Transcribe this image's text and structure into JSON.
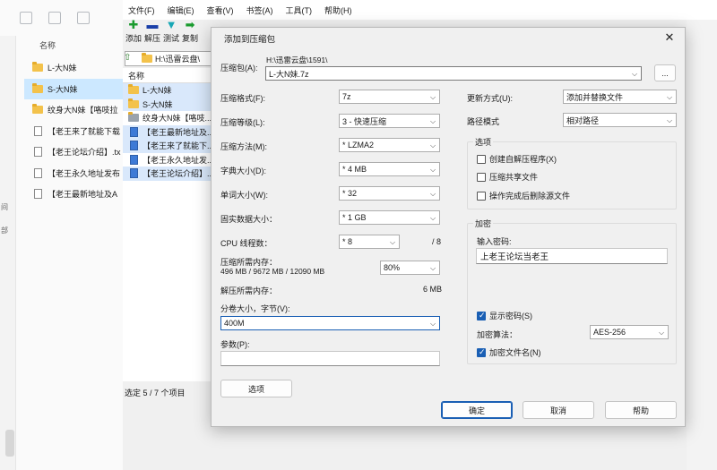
{
  "explorer": {
    "column_header": "名称",
    "gutter_chars": [
      "间",
      "部"
    ],
    "items": [
      {
        "name": "L-大N妹",
        "type": "folder",
        "selected": false
      },
      {
        "name": "S-大N妹",
        "type": "folder",
        "selected": true
      },
      {
        "name": "纹身大N妹【咯吱拉",
        "type": "folder",
        "selected": false
      },
      {
        "name": "【老王来了就能下载",
        "type": "doc",
        "selected": false
      },
      {
        "name": "【老王论坛介绍】.tx",
        "type": "doc",
        "selected": false
      },
      {
        "name": "【老王永久地址发布",
        "type": "doc",
        "selected": false
      },
      {
        "name": "【老王最新地址及A",
        "type": "doc",
        "selected": false
      }
    ]
  },
  "zip_window": {
    "menu": [
      "文件(F)",
      "编辑(E)",
      "查看(V)",
      "书签(A)",
      "工具(T)",
      "帮助(H)"
    ],
    "toolbar": [
      {
        "label": "添加",
        "icon": "add-icon",
        "color": "#1a9b2e",
        "glyph": "✚"
      },
      {
        "label": "解压",
        "icon": "extract-icon",
        "color": "#1a3fa8",
        "glyph": "▬"
      },
      {
        "label": "测试",
        "icon": "test-icon",
        "color": "#18a7b5",
        "glyph": "▼"
      },
      {
        "label": "复制",
        "icon": "copy-icon",
        "color": "#1a9b2e",
        "glyph": "➡"
      }
    ],
    "path": "H:\\迅雷云盘\\",
    "list_header": "名称",
    "files": [
      {
        "name": "L-大N妹",
        "type": "folder"
      },
      {
        "name": "S-大N妹",
        "type": "folder"
      },
      {
        "name": "纹身大N妹【咯吱...",
        "type": "folder-gray"
      },
      {
        "name": "【老王最新地址及...",
        "type": "doc"
      },
      {
        "name": "【老王来了就能下...",
        "type": "doc"
      },
      {
        "name": "【老王永久地址发...",
        "type": "doc"
      },
      {
        "name": "【老王论坛介绍】...",
        "type": "doc"
      }
    ],
    "status": "选定 5 / 7 个项目"
  },
  "dialog": {
    "title": "添加到压缩包",
    "archive_label": "压缩包(A):",
    "archive_dir": "H:\\迅雷云盘\\1591\\",
    "archive_name": "L-大N妹.7z",
    "browse_label": "...",
    "format_label": "压缩格式(F):",
    "format_value": "7z",
    "level_label": "压缩等级(L):",
    "level_value": "3 - 快速压缩",
    "method_label": "压缩方法(M):",
    "method_value": "* LZMA2",
    "dict_label": "字典大小(D):",
    "dict_value": "* 4 MB",
    "word_label": "单词大小(W):",
    "word_value": "* 32",
    "solid_label": "固实数据大小：",
    "solid_value": "* 1 GB",
    "threads_label": "CPU 线程数：",
    "threads_value": "* 8",
    "threads_max": "/ 8",
    "mem_comp_label": "压缩所需内存：",
    "mem_comp_detail": "496 MB / 9672 MB / 12090 MB",
    "mem_percent": "80%",
    "mem_decomp_label": "解压所需内存：",
    "mem_decomp_value": "6 MB",
    "split_label": "分卷大小，字节(V):",
    "split_value": "400M",
    "params_label": "参数(P):",
    "params_value": "",
    "options_button": "选项",
    "update_label": "更新方式(U):",
    "update_value": "添加并替换文件",
    "path_mode_label": "路径模式",
    "path_mode_value": "相对路径",
    "options_group": "选项",
    "opt_sfx": "创建自解压程序(X)",
    "opt_shared": "压缩共享文件",
    "opt_delete": "操作完成后删除源文件",
    "encrypt_group": "加密",
    "password_label": "输入密码:",
    "password_value": "上老王论坛当老王",
    "show_password": "显示密码(S)",
    "enc_method_label": "加密算法：",
    "enc_method_value": "AES-256",
    "encrypt_names": "加密文件名(N)",
    "ok": "确定",
    "cancel": "取消",
    "help": "帮助",
    "accent": "#1a5fb4"
  }
}
